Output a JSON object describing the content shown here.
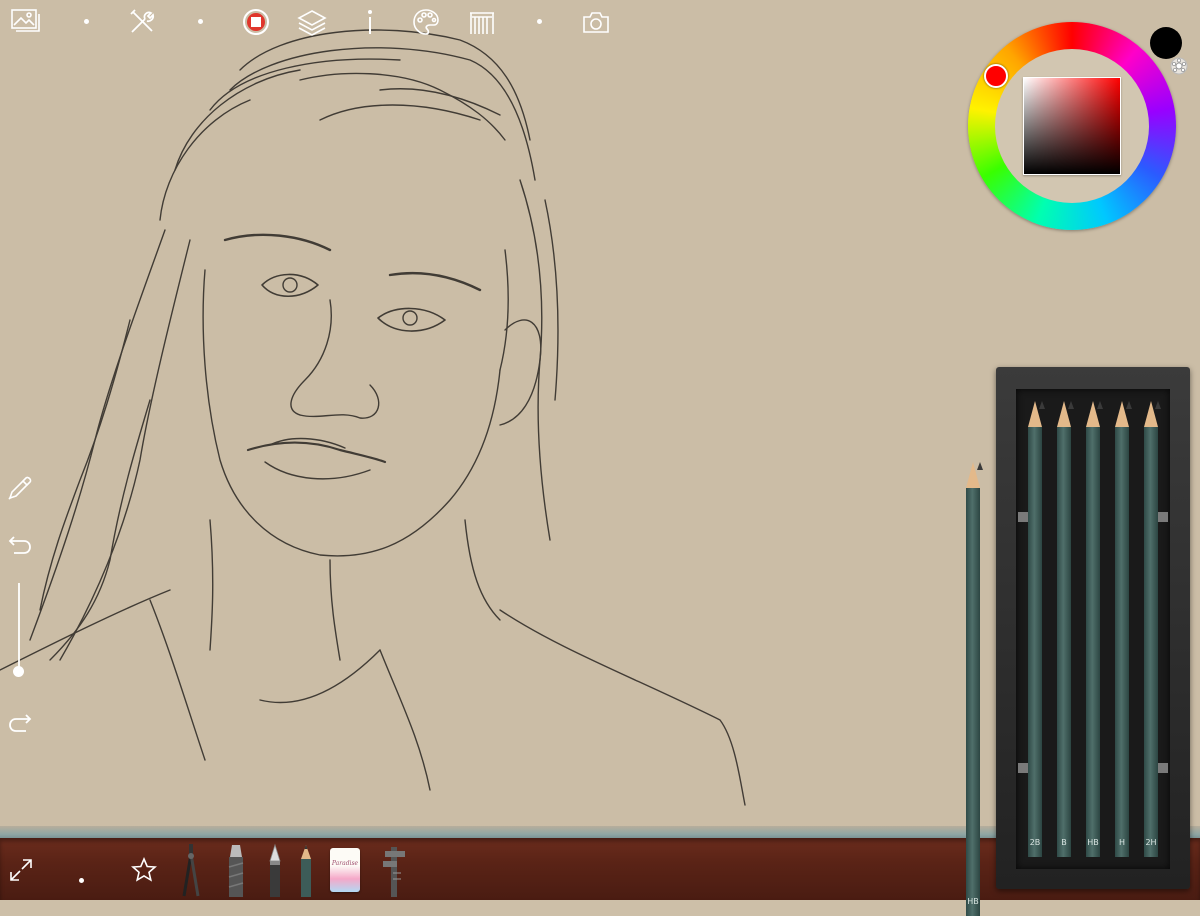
{
  "app": {
    "paper_color": "#cbbda6",
    "shelf_color": "#5a2316"
  },
  "toolbar": {
    "items": [
      {
        "icon": "gallery-icon"
      },
      {
        "icon": "tools-icon"
      },
      {
        "icon": "record-icon"
      },
      {
        "icon": "layers-icon"
      },
      {
        "icon": "info-icon"
      },
      {
        "icon": "palette-icon"
      },
      {
        "icon": "canvas-icon"
      },
      {
        "icon": "camera-icon"
      }
    ]
  },
  "side_tools": {
    "items": [
      {
        "icon": "eyedropper-icon"
      },
      {
        "icon": "undo-icon"
      },
      {
        "icon": "brush-size-slider"
      },
      {
        "icon": "redo-icon"
      }
    ],
    "brush_size_fraction": 0.05
  },
  "color_picker": {
    "current_color": "#000000",
    "hue_color": "#ff0000",
    "selected_color": "#ff0000"
  },
  "pencil_box": {
    "pencil_brand": "MERALD GREY PENCIL",
    "pencils": [
      {
        "grade": "2B",
        "color": "#3d5c58"
      },
      {
        "grade": "B",
        "color": "#3d5c58"
      },
      {
        "grade": "HB",
        "color": "#3d5c58"
      },
      {
        "grade": "H",
        "color": "#3d5c58"
      },
      {
        "grade": "2H",
        "color": "#3d5c58"
      }
    ],
    "active_pencil_grade": "HB"
  },
  "bottom_tools": {
    "items": [
      {
        "icon": "fullscreen-icon"
      },
      {
        "icon": "favorites-star-icon"
      },
      {
        "icon": "compass-icon"
      },
      {
        "icon": "cutter-icon"
      },
      {
        "icon": "knife-icon"
      },
      {
        "icon": "pencil-icon"
      },
      {
        "icon": "eraser-icon"
      },
      {
        "icon": "caliper-icon"
      }
    ],
    "eraser_brand": "Paradise"
  }
}
